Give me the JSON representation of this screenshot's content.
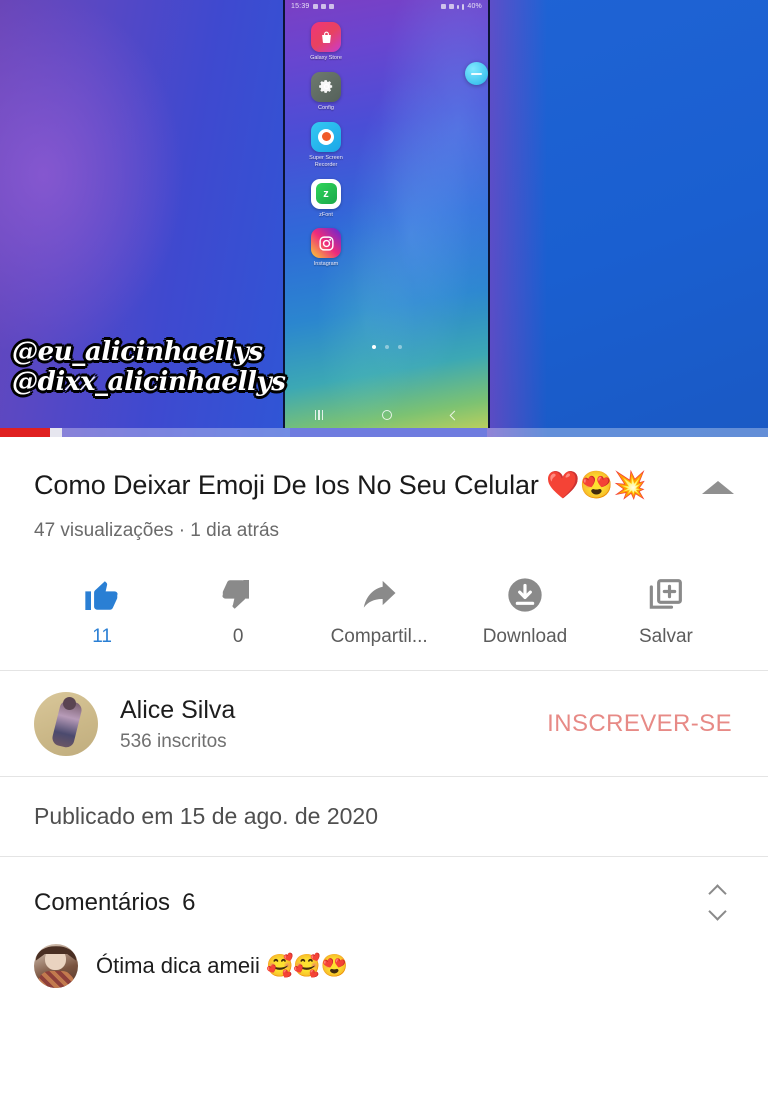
{
  "player": {
    "progress": {
      "played_pct": 6.5,
      "buffered_pct": 8.1
    },
    "watermark": {
      "line1": "@eu_alicinhaellys",
      "line2": "@dixx_alicinhaellys"
    },
    "phone_screen": {
      "status_bar": {
        "time": "15:39",
        "battery": "40%"
      },
      "apps": [
        {
          "label": "Galaxy Store",
          "icon": "shopping-bag-icon"
        },
        {
          "label": "Config",
          "icon": "gear-icon"
        },
        {
          "label": "Super Screen Recorder",
          "icon": "record-icon"
        },
        {
          "label": "zFont",
          "icon": "zfont-icon"
        },
        {
          "label": "Instagram",
          "icon": "instagram-icon"
        }
      ],
      "page_dots": 3,
      "active_dot": 1,
      "floating_button": "floating-recorder-button",
      "nav": {
        "recents": "recents-icon",
        "home": "home-icon",
        "back": "back-icon"
      }
    }
  },
  "video": {
    "title": "Como Deixar Emoji De Ios No Seu Celular ❤️😍💥",
    "views_line": "47 visualizações · 1 dia atrás",
    "collapse_icon": "chevron-up-icon"
  },
  "actions": [
    {
      "label": "11",
      "icon": "thumbs-up-icon",
      "active": true
    },
    {
      "label": "0",
      "icon": "thumbs-down-icon",
      "active": false
    },
    {
      "label": "Compartil...",
      "icon": "share-icon",
      "active": false
    },
    {
      "label": "Download",
      "icon": "download-icon",
      "active": false
    },
    {
      "label": "Salvar",
      "icon": "save-playlist-icon",
      "active": false
    }
  ],
  "channel": {
    "name": "Alice Silva",
    "subscribers": "536 inscritos",
    "subscribe_label": "INSCREVER-SE",
    "avatar": "channel-avatar"
  },
  "published": "Publicado em 15 de ago. de 2020",
  "comments": {
    "heading": "Comentários",
    "count": "6",
    "sort_icon": "sort-icon",
    "items": [
      {
        "text": "Ótima dica ameii 🥰🥰😍",
        "avatar": "comment-avatar"
      }
    ]
  },
  "colors": {
    "like_blue": "#2a7fd4",
    "subscribe_red": "#e78a86",
    "progress_red": "#e02020",
    "text_primary": "#1a1a1a",
    "text_secondary": "#6a6a6a"
  }
}
